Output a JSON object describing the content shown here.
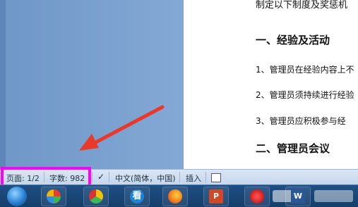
{
  "document": {
    "top_line": "制定以下制度及奖惩机",
    "heading1": "一、经验及活动",
    "item1": "1、管理员在经验内容上不",
    "item2": "2、管理员须持续进行经验",
    "item3": "3、管理员应积极参与经",
    "heading2": "二、管理员会议"
  },
  "status_bar": {
    "page_label": "页面: 1/2",
    "word_label": "字数: 982",
    "language": "中文(简体，中国)",
    "insert_mode": "插入"
  },
  "taskbar": {
    "items": [
      "start-orb",
      "windows-pinwheel",
      "ball",
      "search-k",
      "firefox",
      "powerpoint",
      "browser-red",
      "word"
    ]
  },
  "colors": {
    "highlight": "#ff00ff",
    "arrow": "#e8392b",
    "status_bg": "#dbe6f4"
  }
}
